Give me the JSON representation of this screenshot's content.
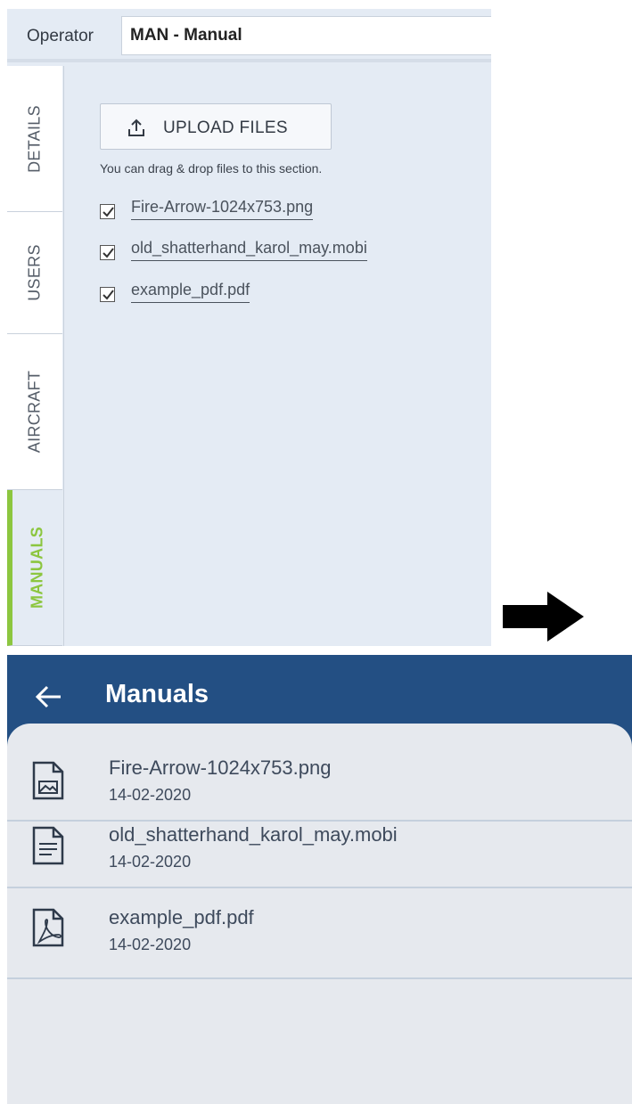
{
  "operator": {
    "label": "Operator",
    "value": "MAN - Manual"
  },
  "tabs": [
    {
      "label": "DETAILS"
    },
    {
      "label": "USERS"
    },
    {
      "label": "AIRCRAFT"
    },
    {
      "label": "MANUALS"
    }
  ],
  "upload": {
    "button_label": "UPLOAD FILES",
    "hint": "You can drag & drop files to this section."
  },
  "files": [
    {
      "name": "Fire-Arrow-1024x753.png",
      "checked": true
    },
    {
      "name": "old_shatterhand_karol_may.mobi",
      "checked": true
    },
    {
      "name": "example_pdf.pdf",
      "checked": true
    }
  ],
  "mobile": {
    "title": "Manuals",
    "header_color": "#234f83",
    "items": [
      {
        "name": "Fire-Arrow-1024x753.png",
        "date": "14-02-2020",
        "icon": "image-file-icon"
      },
      {
        "name": "old_shatterhand_karol_may.mobi",
        "date": "14-02-2020",
        "icon": "text-file-icon"
      },
      {
        "name": "example_pdf.pdf",
        "date": "14-02-2020",
        "icon": "pdf-file-icon"
      }
    ]
  },
  "colors": {
    "accent": "#8cc63f",
    "panel": "#e4ebf4",
    "list_bg": "#e6e9ee"
  }
}
